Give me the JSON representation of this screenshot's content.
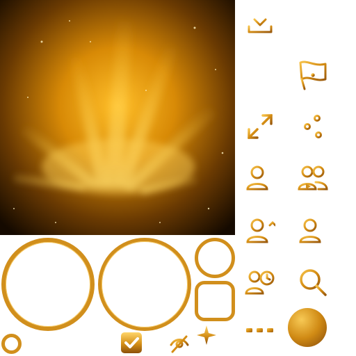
{
  "sheet": {
    "accent_gold": "#d79a1c",
    "accent_light": "#ffd76a",
    "accent_dark": "#8a4e0a",
    "background": "#ffffff",
    "hero_image": "golden-aurora-starfield"
  },
  "icons": [
    "download-icon",
    "flag-alert-icon",
    "expand-icon",
    "sliders-icon",
    "user-remove-icon",
    "user-group-video-icon",
    "user-upload-icon",
    "user-add-icon",
    "user-clock-icon",
    "zoom-out-icon",
    "more-dots-icon",
    "gold-circle-icon",
    "checkbox-checked-icon",
    "eye-off-icon",
    "sparkle-icon",
    "small-ring-icon"
  ]
}
